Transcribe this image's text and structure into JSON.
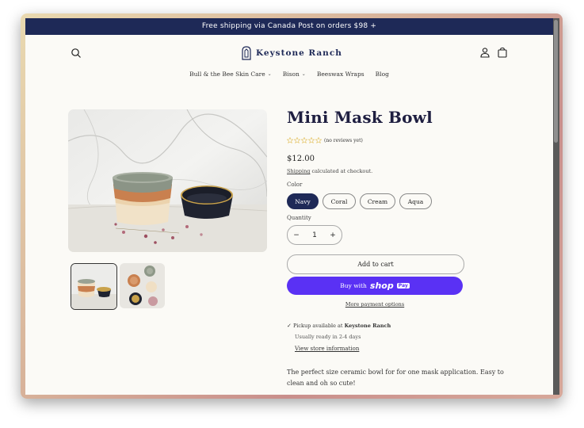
{
  "announcement": "Free shipping via Canada Post on orders $98 +",
  "header": {
    "logo_text": "Keystone Ranch",
    "search_icon": "search-icon",
    "account_icon": "account-icon",
    "cart_icon": "cart-icon"
  },
  "nav": {
    "items": [
      {
        "label": "Bull & the Bee Skin Care",
        "dropdown": true
      },
      {
        "label": "Bison",
        "dropdown": true
      },
      {
        "label": "Beeswax Wraps",
        "dropdown": false
      },
      {
        "label": "Blog",
        "dropdown": false
      }
    ]
  },
  "product": {
    "title": "Mini Mask Bowl",
    "rating_stars": 0,
    "reviews": "(no reviews yet)",
    "price": "$12.00",
    "shipping_link": "Shipping",
    "shipping_rest": " calculated at checkout.",
    "color_label": "Color",
    "colors": [
      "Navy",
      "Coral",
      "Cream",
      "Aqua"
    ],
    "selected_color": "Navy",
    "quantity_label": "Quantity",
    "quantity": "1",
    "minus": "−",
    "plus": "+",
    "add_to_cart": "Add to cart",
    "buy_with": "Buy with",
    "shop_brand": "shop",
    "shop_pay": "Pay",
    "more_payment": "More payment options",
    "pickup_prefix": "Pickup available at ",
    "pickup_store": "Keystone Ranch",
    "ready_text": "Usually ready in 2-4 days",
    "store_info": "View store information",
    "description": "The perfect size ceramic bowl for for one mask application. Easy to clean and oh so cute!"
  },
  "colors": {
    "brand_navy": "#1e2957",
    "shop_purple": "#5a31f4",
    "star": "#e0b94a"
  }
}
